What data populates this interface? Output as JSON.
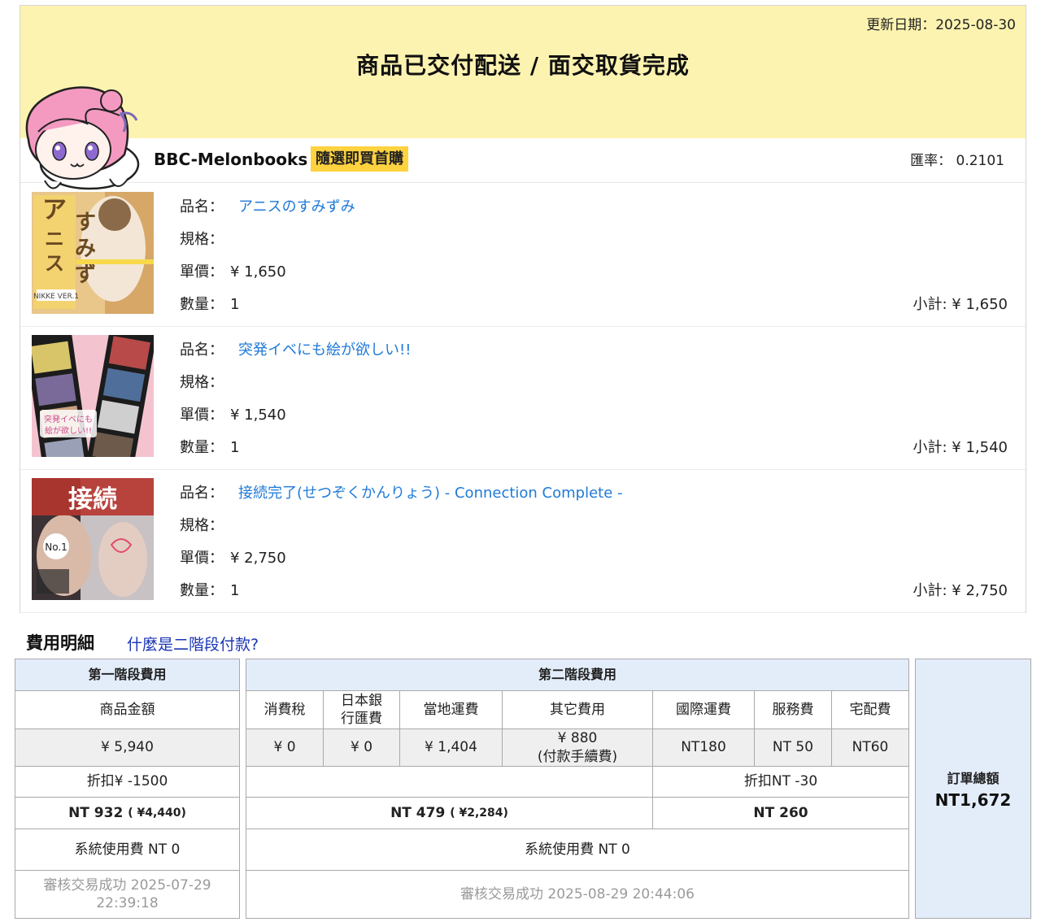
{
  "banner": {
    "update_label": "更新日期：",
    "update_date": "2025-08-30",
    "status_title": "商品已交付配送 / 面交取貨完成"
  },
  "shop": {
    "name": "BBC-Melonbooks",
    "badge": "隨選即買首購",
    "rate_label": "匯率：",
    "rate_value": "0.2101"
  },
  "labels": {
    "name": "品名：",
    "spec": "規格：",
    "price": "單價：",
    "qty": "數量：",
    "subtotal": "小計:"
  },
  "items": [
    {
      "title": "アニスのすみずみ",
      "spec": "",
      "price": "¥ 1,650",
      "qty": "1",
      "subtotal": "¥ 1,650",
      "cover_text": "アニスのすみずみ",
      "cover_sub": "NIKKE VER.1"
    },
    {
      "title": "突発イベにも絵が欲しい!!",
      "spec": "",
      "price": "¥ 1,540",
      "qty": "1",
      "subtotal": "¥ 1,540",
      "cover_text": "突発イベにも絵が欲しい!!"
    },
    {
      "title": "接続完了(せつぞくかんりょう) - Connection Complete -",
      "spec": "",
      "price": "¥ 2,750",
      "qty": "1",
      "subtotal": "¥ 2,750",
      "cover_text": "接続完了"
    }
  ],
  "fees": {
    "heading": "費用明細",
    "help_link": "什麼是二階段付款?",
    "phase1": {
      "header": "第一階段費用",
      "col_label": "商品金額",
      "amount": "¥ 5,940",
      "discount": "折扣¥ -1500",
      "total_nt": "NT 932",
      "total_jpy": "( ¥4,440)",
      "system_fee": "系統使用費 NT 0",
      "review_status": "審核交易成功 2025-07-29 22:39:18"
    },
    "phase2": {
      "header": "第二階段費用",
      "columns": [
        "消費稅",
        "日本銀行匯費",
        "當地運費",
        "其它費用",
        "國際運費",
        "服務費",
        "宅配費"
      ],
      "column_lines": [
        [
          "消費稅"
        ],
        [
          "日本銀",
          "行匯費"
        ],
        [
          "當地運費"
        ],
        [
          "其它費用"
        ],
        [
          "國際運費"
        ],
        [
          "服務費"
        ],
        [
          "宅配費"
        ]
      ],
      "values": [
        "¥ 0",
        "¥ 0",
        "¥ 1,404",
        "¥ 880",
        "NT180",
        "NT 50",
        "NT60"
      ],
      "other_fee_note": "(付款手續費)",
      "discount": "折扣NT -30",
      "total_nt": "NT 479",
      "total_jpy": "( ¥2,284)",
      "total2": "NT 260",
      "system_fee": "系統使用費 NT 0",
      "review_status": "審核交易成功 2025-08-29 20:44:06"
    },
    "order_total": {
      "label": "訂單總額",
      "value": "NT1,672"
    }
  },
  "colors": {
    "banner": "#fdf3b0",
    "badge": "#ffd23f",
    "link": "#1f7ad8",
    "header_bg": "#e3edfa",
    "grey_row": "#efefef"
  }
}
